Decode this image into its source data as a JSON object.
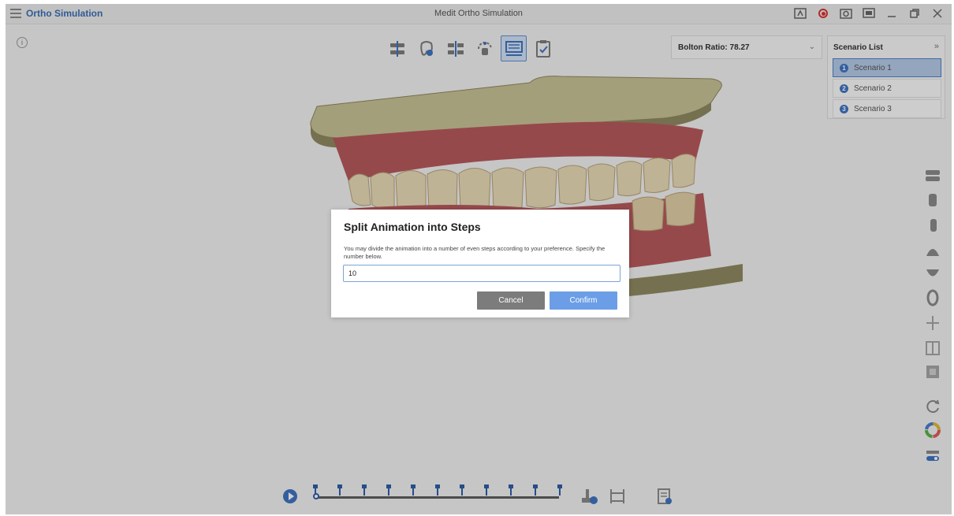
{
  "titlebar": {
    "app_title": "Ortho Simulation",
    "window_title": "Medit Ortho Simulation"
  },
  "info": {
    "glyph": "i"
  },
  "bolton": {
    "label": "Bolton Ratio: 78.27"
  },
  "scenario_panel": {
    "header": "Scenario List",
    "items": [
      {
        "num": "1",
        "label": "Scenario 1",
        "selected": true
      },
      {
        "num": "2",
        "label": "Scenario 2",
        "selected": false
      },
      {
        "num": "3",
        "label": "Scenario 3",
        "selected": false
      }
    ]
  },
  "dialog": {
    "title": "Split Animation into Steps",
    "description": "You may divide the animation into a number of even steps according to your preference. Specify the number below.",
    "input_value": "10",
    "cancel_label": "Cancel",
    "confirm_label": "Confirm"
  },
  "timeline": {
    "steps": 10,
    "current_step": 0
  },
  "colors": {
    "accent": "#3f74c2",
    "confirm": "#6b9ee6",
    "cancel": "#7c7c7c"
  }
}
